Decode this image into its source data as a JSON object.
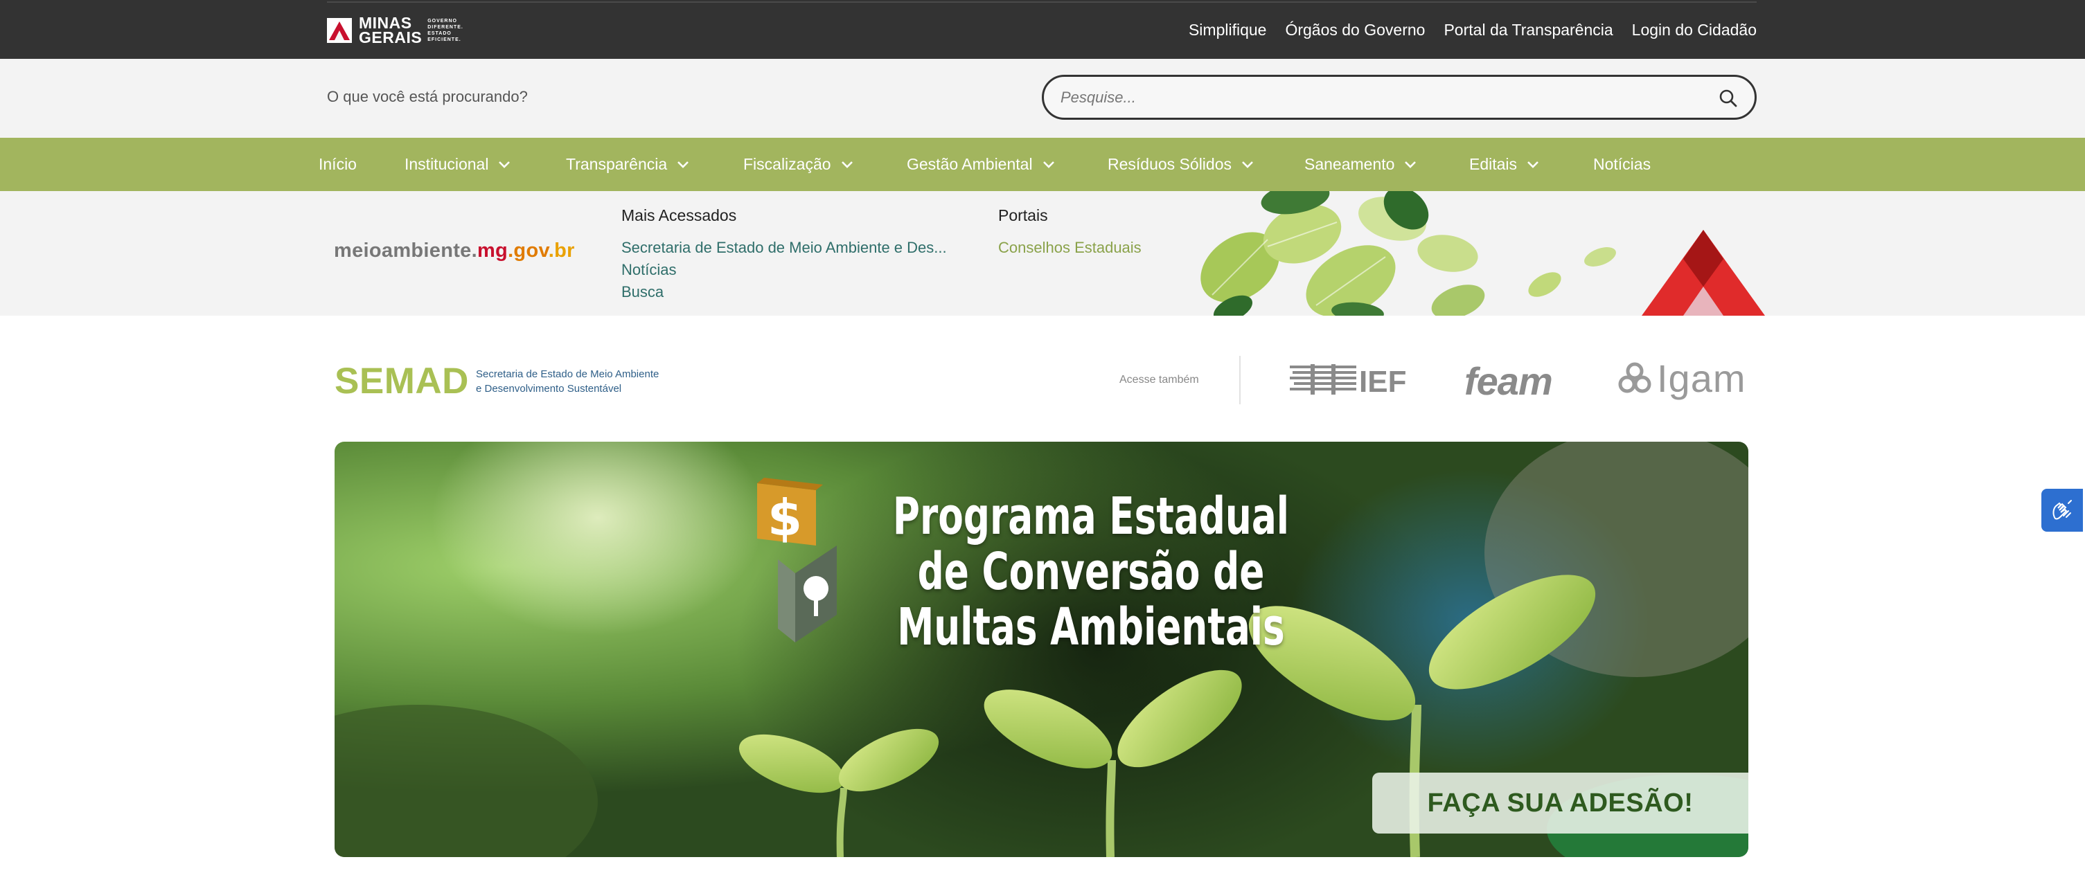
{
  "topbar": {
    "logo": {
      "line1": "MINAS",
      "line2": "GERAIS",
      "tag1": "GOVERNO",
      "tag2": "DIFERENTE.",
      "tag3": "ESTADO",
      "tag4": "EFICIENTE."
    },
    "links": [
      "Simplifique",
      "Órgãos do Governo",
      "Portal da Transparência",
      "Login do Cidadão"
    ]
  },
  "search": {
    "prompt": "O que você está procurando?",
    "placeholder": "Pesquise..."
  },
  "nav": {
    "items": [
      {
        "label": "Início",
        "dropdown": false
      },
      {
        "label": "Institucional",
        "dropdown": true
      },
      {
        "label": "Transparência",
        "dropdown": true
      },
      {
        "label": "Fiscalização",
        "dropdown": true
      },
      {
        "label": "Gestão Ambiental",
        "dropdown": true
      },
      {
        "label": "Resíduos Sólidos",
        "dropdown": true
      },
      {
        "label": "Saneamento",
        "dropdown": true
      },
      {
        "label": "Editais",
        "dropdown": true
      },
      {
        "label": "Notícias",
        "dropdown": false
      }
    ]
  },
  "mega": {
    "domain": {
      "part1": "meioambiente.",
      "part2": "mg",
      "part3": ".gov",
      "part4": ".br"
    },
    "mais_acessados": {
      "title": "Mais Acessados",
      "links": [
        "Secretaria de Estado de Meio Ambiente e Des...",
        "Notícias",
        "Busca"
      ]
    },
    "portais": {
      "title": "Portais",
      "links": [
        "Conselhos Estaduais"
      ]
    }
  },
  "agencies": {
    "semad": "SEMAD",
    "semad_sub1": "Secretaria de Estado de Meio Ambiente",
    "semad_sub2": "e Desenvolvimento Sustentável",
    "acesse": "Acesse também",
    "ief": "IEF",
    "feam": "feam",
    "igam": "Igam"
  },
  "banner": {
    "title_lines": [
      "Programa Estadual",
      "de Conversão de",
      "Multas Ambientais"
    ],
    "cta": "FAÇA SUA ADESÃO!"
  },
  "colors": {
    "topbar": "#333333",
    "nav_green": "#a2b55e",
    "semad_green": "#a9c054",
    "mg_red": "#c8102e",
    "cta_text": "#2e5a1f",
    "a11y_blue": "#2d6fd0"
  }
}
